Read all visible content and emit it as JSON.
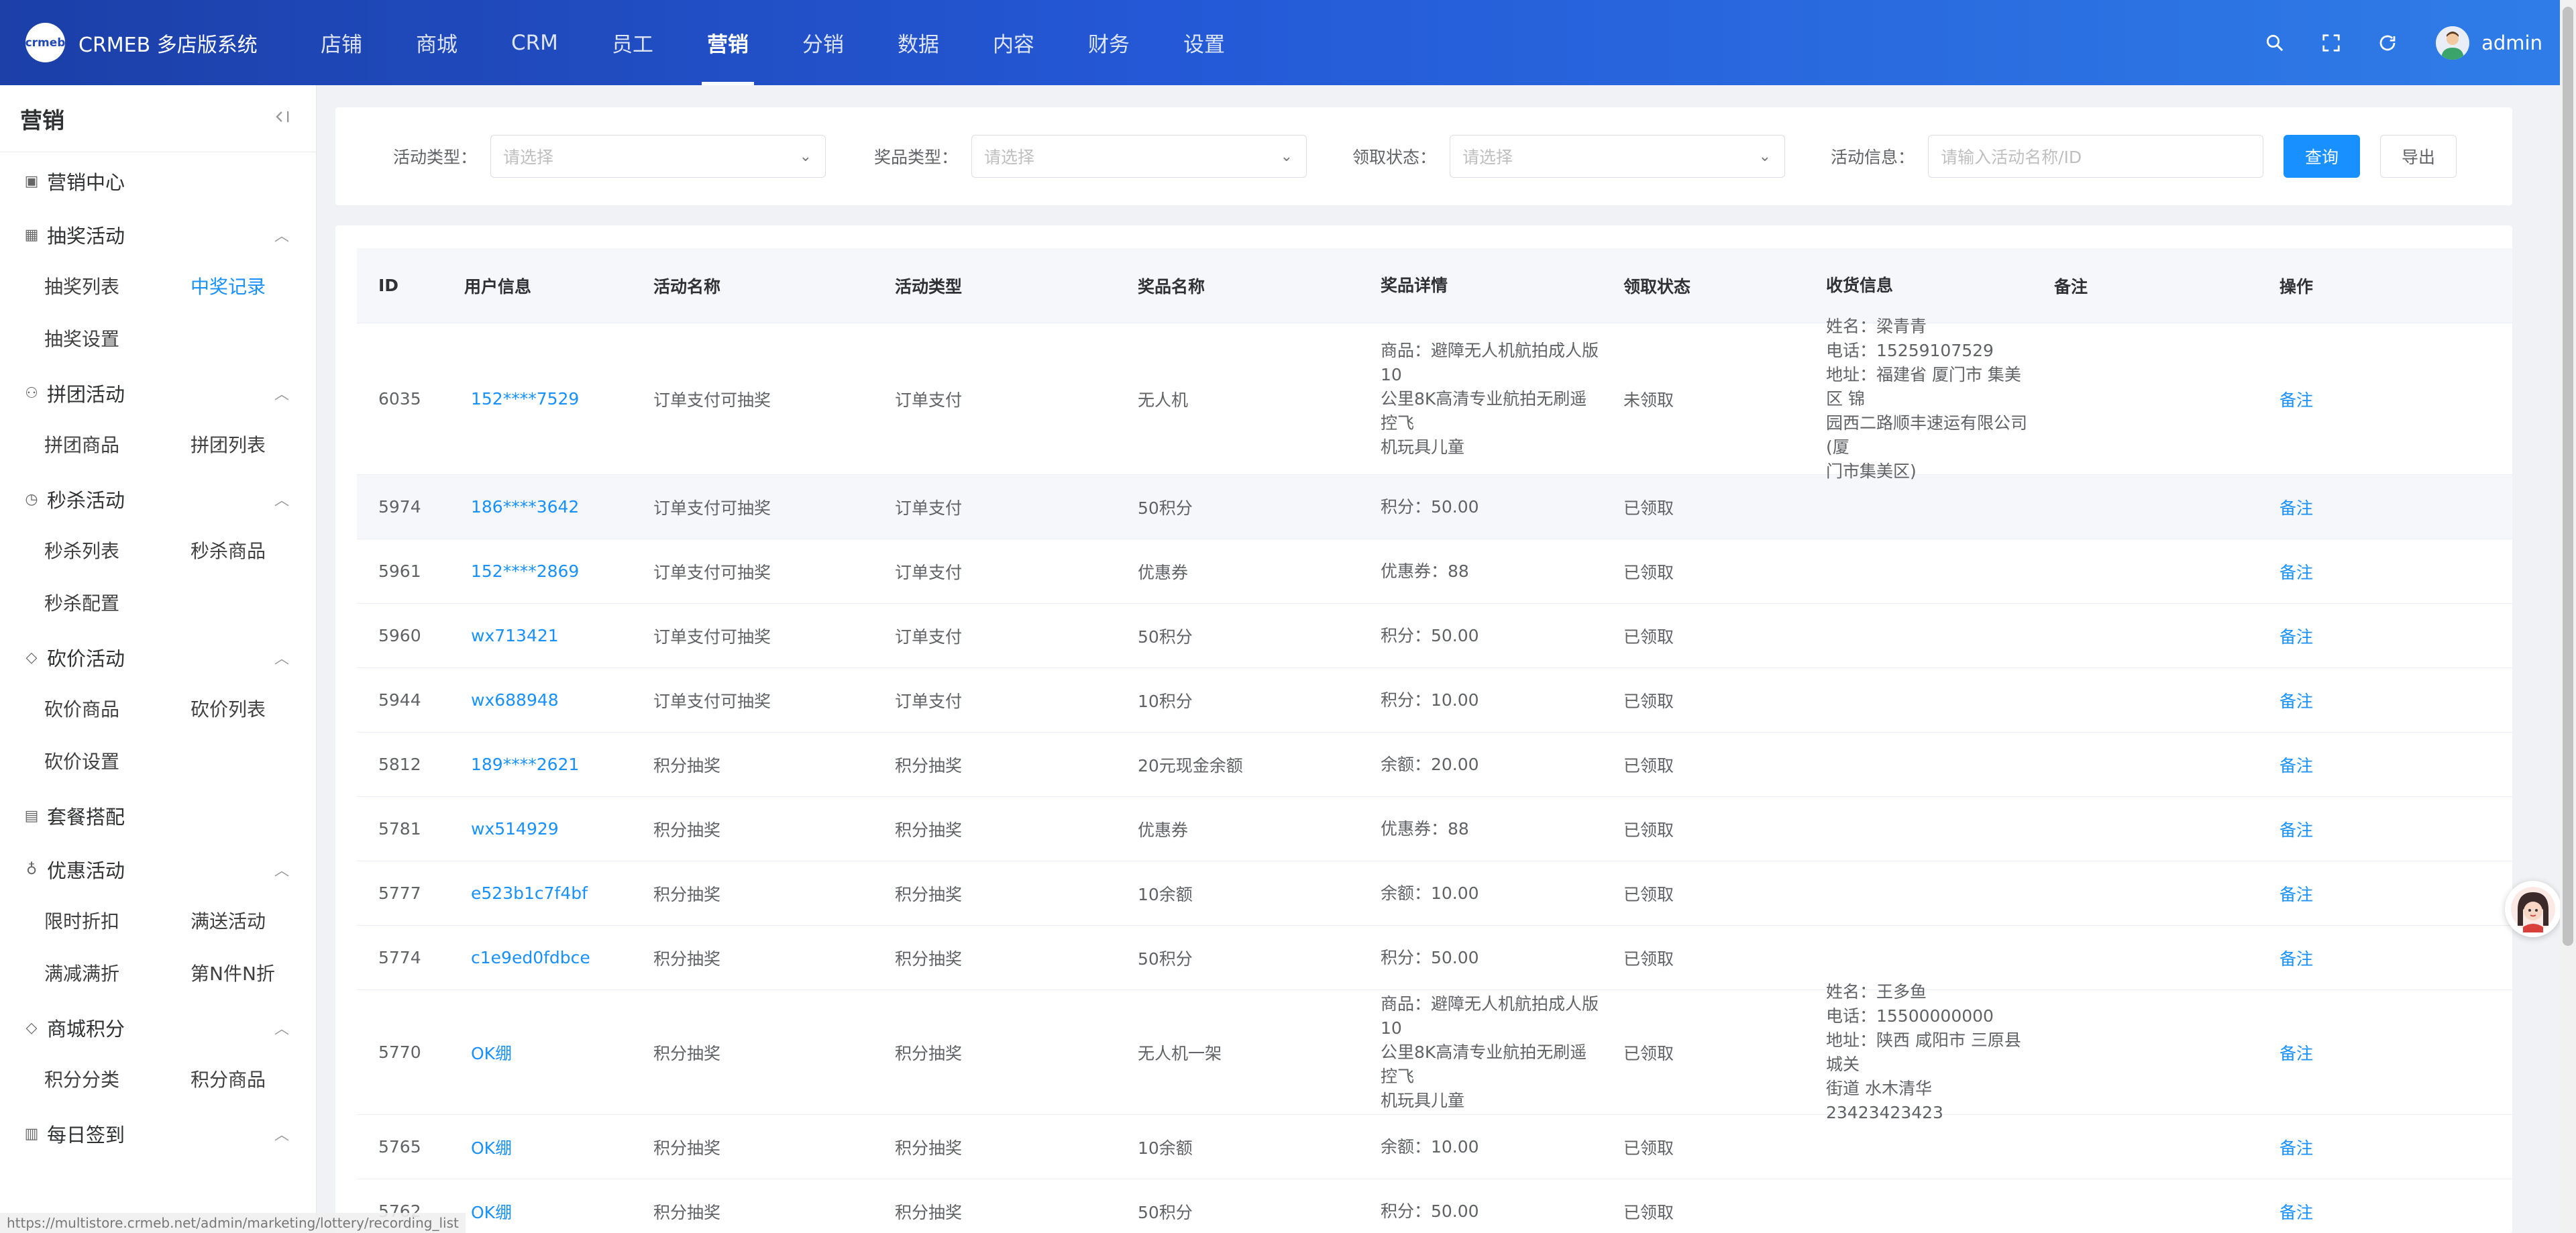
{
  "header": {
    "logo_text": "CRMEB 多店版系统",
    "logo_mark": "crmeb",
    "nav": [
      "店铺",
      "商城",
      "CRM",
      "员工",
      "营销",
      "分销",
      "数据",
      "内容",
      "财务",
      "设置"
    ],
    "active_nav": "营销",
    "user": "admin"
  },
  "sidebar": {
    "title": "营销",
    "groups": [
      {
        "label": "营销中心",
        "icon": "shop-icon",
        "expandable": false,
        "items": []
      },
      {
        "label": "抽奖活动",
        "icon": "grid-icon",
        "expandable": true,
        "items": [
          "抽奖列表",
          "中奖记录",
          "抽奖设置"
        ]
      },
      {
        "label": "拼团活动",
        "icon": "group-icon",
        "expandable": true,
        "items": [
          "拼团商品",
          "拼团列表"
        ]
      },
      {
        "label": "秒杀活动",
        "icon": "alarm-icon",
        "expandable": true,
        "items": [
          "秒杀列表",
          "秒杀商品",
          "秒杀配置"
        ]
      },
      {
        "label": "砍价活动",
        "icon": "tag-icon",
        "expandable": true,
        "items": [
          "砍价商品",
          "砍价列表",
          "砍价设置"
        ]
      },
      {
        "label": "套餐搭配",
        "icon": "package-icon",
        "expandable": false,
        "items": []
      },
      {
        "label": "优惠活动",
        "icon": "discount-icon",
        "expandable": true,
        "items": [
          "限时折扣",
          "满送活动",
          "满减满折",
          "第N件N折"
        ]
      },
      {
        "label": "商城积分",
        "icon": "points-icon",
        "expandable": true,
        "items": [
          "积分分类",
          "积分商品"
        ]
      },
      {
        "label": "每日签到",
        "icon": "calendar-icon",
        "expandable": true,
        "items": []
      }
    ],
    "active_item": "中奖记录"
  },
  "filters": {
    "activity_type_label": "活动类型：",
    "activity_type_placeholder": "请选择",
    "prize_type_label": "奖品类型：",
    "prize_type_placeholder": "请选择",
    "claim_status_label": "领取状态：",
    "claim_status_placeholder": "请选择",
    "activity_info_label": "活动信息：",
    "activity_info_placeholder": "请输入活动名称/ID",
    "search_button": "查询",
    "export_button": "导出"
  },
  "table": {
    "columns": [
      "ID",
      "用户信息",
      "活动名称",
      "活动类型",
      "奖品名称",
      "奖品详情",
      "领取状态",
      "收货信息",
      "备注",
      "操作"
    ],
    "rows": [
      {
        "id": "6035",
        "user": "152****7529",
        "activity": "订单支付可抽奖",
        "type": "订单支付",
        "prize": "无人机",
        "detail": [
          "商品：避障无人机航拍成人版10",
          "公里8K高清专业航拍无刷遥控飞",
          "机玩具儿童"
        ],
        "status": "未领取",
        "ship": [
          "姓名：梁青青",
          "电话：15259107529",
          "地址：福建省 厦门市 集美区 锦",
          "园西二路顺丰速运有限公司(厦",
          "门市集美区)"
        ],
        "note": "",
        "op": "备注"
      },
      {
        "id": "5974",
        "user": "186****3642",
        "activity": "订单支付可抽奖",
        "type": "订单支付",
        "prize": "50积分",
        "detail": [
          "积分：50.00"
        ],
        "status": "已领取",
        "ship": [],
        "note": "",
        "op": "备注"
      },
      {
        "id": "5961",
        "user": "152****2869",
        "activity": "订单支付可抽奖",
        "type": "订单支付",
        "prize": "优惠券",
        "detail": [
          "优惠券：88"
        ],
        "status": "已领取",
        "ship": [],
        "note": "",
        "op": "备注"
      },
      {
        "id": "5960",
        "user": "wx713421",
        "activity": "订单支付可抽奖",
        "type": "订单支付",
        "prize": "50积分",
        "detail": [
          "积分：50.00"
        ],
        "status": "已领取",
        "ship": [],
        "note": "",
        "op": "备注"
      },
      {
        "id": "5944",
        "user": "wx688948",
        "activity": "订单支付可抽奖",
        "type": "订单支付",
        "prize": "10积分",
        "detail": [
          "积分：10.00"
        ],
        "status": "已领取",
        "ship": [],
        "note": "",
        "op": "备注"
      },
      {
        "id": "5812",
        "user": "189****2621",
        "activity": "积分抽奖",
        "type": "积分抽奖",
        "prize": "20元现金余额",
        "detail": [
          "余额：20.00"
        ],
        "status": "已领取",
        "ship": [],
        "note": "",
        "op": "备注"
      },
      {
        "id": "5781",
        "user": "wx514929",
        "activity": "积分抽奖",
        "type": "积分抽奖",
        "prize": "优惠券",
        "detail": [
          "优惠券：88"
        ],
        "status": "已领取",
        "ship": [],
        "note": "",
        "op": "备注"
      },
      {
        "id": "5777",
        "user": "e523b1c7f4bf",
        "activity": "积分抽奖",
        "type": "积分抽奖",
        "prize": "10余额",
        "detail": [
          "余额：10.00"
        ],
        "status": "已领取",
        "ship": [],
        "note": "",
        "op": "备注"
      },
      {
        "id": "5774",
        "user": "c1e9ed0fdbce",
        "activity": "积分抽奖",
        "type": "积分抽奖",
        "prize": "50积分",
        "detail": [
          "积分：50.00"
        ],
        "status": "已领取",
        "ship": [],
        "note": "",
        "op": "备注"
      },
      {
        "id": "5770",
        "user": "OK绷",
        "activity": "积分抽奖",
        "type": "积分抽奖",
        "prize": "无人机一架",
        "detail": [
          "商品：避障无人机航拍成人版10",
          "公里8K高清专业航拍无刷遥控飞",
          "机玩具儿童"
        ],
        "status": "已领取",
        "ship": [
          "姓名：王多鱼",
          "电话：15500000000",
          "地址：陕西 咸阳市 三原县 城关",
          "街道 水木清华23423423423"
        ],
        "note": "",
        "op": "备注"
      },
      {
        "id": "5765",
        "user": "OK绷",
        "activity": "积分抽奖",
        "type": "积分抽奖",
        "prize": "10余额",
        "detail": [
          "余额：10.00"
        ],
        "status": "已领取",
        "ship": [],
        "note": "",
        "op": "备注"
      },
      {
        "id": "5762",
        "user": "OK绷",
        "activity": "积分抽奖",
        "type": "积分抽奖",
        "prize": "50积分",
        "detail": [
          "积分：50.00"
        ],
        "status": "已领取",
        "ship": [],
        "note": "",
        "op": "备注"
      }
    ]
  },
  "status_bar": "https://multistore.crmeb.net/admin/marketing/lottery/recording_list",
  "colors": {
    "header_start": "#1c3fa8",
    "header_end": "#2f7de8",
    "accent": "#1890ff"
  }
}
